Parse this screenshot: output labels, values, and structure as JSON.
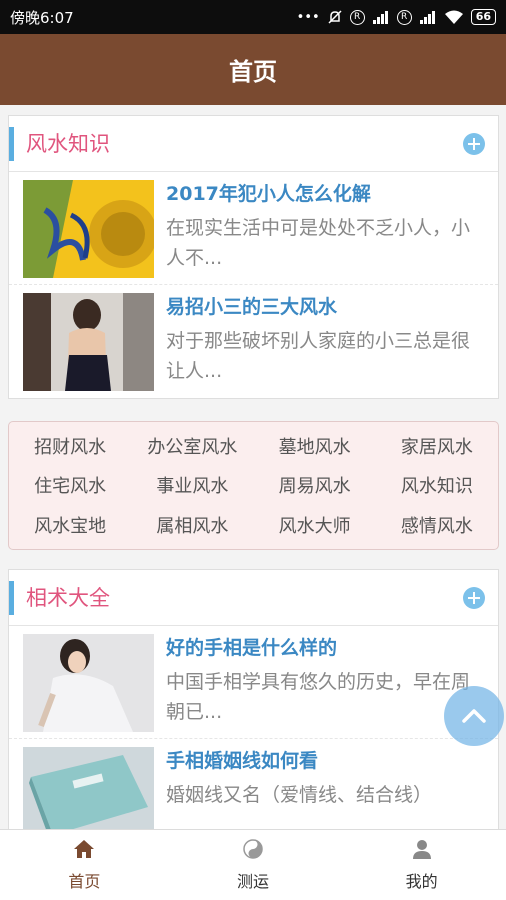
{
  "status_bar": {
    "time": "傍晚6:07",
    "signal_r": "R",
    "battery": "66"
  },
  "header": {
    "title": "首页"
  },
  "fengshui_section": {
    "title": "风水知识",
    "articles": [
      {
        "title": "2017年犯小人怎么化解",
        "desc": "在现实生活中可是处处不乏小人，小人不..."
      },
      {
        "title": "易招小三的三大风水",
        "desc": "对于那些破坏别人家庭的小三总是很让人..."
      }
    ]
  },
  "tags": [
    "招财风水",
    "办公室风水",
    "墓地风水",
    "家居风水",
    "住宅风水",
    "事业风水",
    "周易风水",
    "风水知识",
    "风水宝地",
    "属相风水",
    "风水大师",
    "感情风水"
  ],
  "xiangshu_section": {
    "title": "相术大全",
    "articles": [
      {
        "title": "好的手相是什么样的",
        "desc": "中国手相学具有悠久的历史，早在周朝已..."
      },
      {
        "title": "手相婚姻线如何看",
        "desc": "婚姻线又名（爱情线、结合线）"
      }
    ]
  },
  "tabbar": {
    "items": [
      {
        "label": "首页",
        "icon": "home-icon"
      },
      {
        "label": "测运",
        "icon": "yin-yang-icon"
      },
      {
        "label": "我的",
        "icon": "user-icon"
      }
    ]
  },
  "colors": {
    "header": "#7a4a30",
    "accent_title": "#e0557e",
    "link": "#3b88c3",
    "plus": "#7cc1ea"
  }
}
